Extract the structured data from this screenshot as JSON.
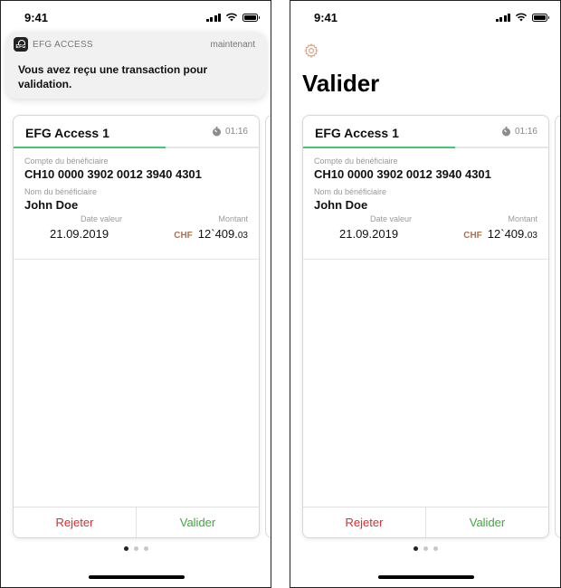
{
  "colors": {
    "progress": "#4cc477",
    "reject": "#e02a2a",
    "validate": "#3fa83a",
    "currency": "#b0714d",
    "settings_icon": "#d9a589"
  },
  "status_bar": {
    "time": "9:41"
  },
  "notification": {
    "app_name": "EFG ACCESS",
    "time": "maintenant",
    "message": "Vous avez reçu une transaction pour validation.",
    "app_icon_text": "EFG"
  },
  "page": {
    "title": "Valider",
    "settings_icon": "gear-icon"
  },
  "card": {
    "title": "EFG Access 1",
    "timer": "01:16",
    "timer_progress": 0.62,
    "account_label": "Compte du bénéficiaire",
    "account_value": "CH10 0000 3902 0012 3940 4301",
    "beneficiary_label": "Nom du bénéficiaire",
    "beneficiary_value": "John Doe",
    "date_label": "Date valeur",
    "date_value": "21.09.2019",
    "amount_label": "Montant",
    "currency": "CHF",
    "amount_main": "12`409.",
    "amount_cents": "03",
    "reject_label": "Rejeter",
    "validate_label": "Valider"
  },
  "pagination": {
    "count": 3,
    "active": 1
  }
}
